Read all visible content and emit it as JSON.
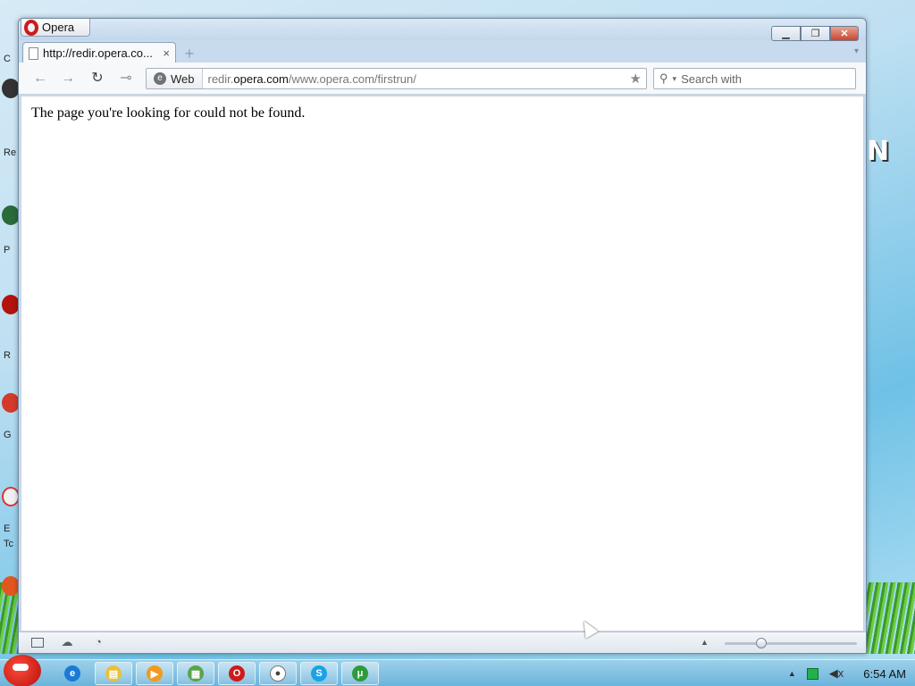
{
  "desktop": {
    "labels": [
      "C",
      "Re",
      "P",
      "R",
      "G",
      "E",
      "Tc"
    ],
    "watermark": "N"
  },
  "window": {
    "menu_label": "Opera",
    "controls": {
      "minimize": "▁",
      "restore": "❐",
      "close": "✕"
    },
    "tab": {
      "title": "http://redir.opera.co...",
      "close": "×"
    },
    "new_tab": "+",
    "tab_list": "▾"
  },
  "toolbar": {
    "back": "←",
    "forward": "→",
    "reload": "↻",
    "key": "⊸",
    "address": {
      "badge_icon": "e",
      "badge_label": "Web",
      "url_prefix": "redir.",
      "url_domain": "opera.com",
      "url_path": "/www.opera.com/firstrun/",
      "star": "★"
    },
    "search": {
      "icon": "⚲",
      "caret": "▾",
      "placeholder": "Search with"
    }
  },
  "content": {
    "message": "The page you're looking for could not be found."
  },
  "statusbar": {
    "panel_icon": "",
    "cloud_icon": "☁",
    "speed_icon": "◔",
    "up_arrow": "▲",
    "zoom_fraction": 0.28
  },
  "taskbar": {
    "items": [
      {
        "name": "ie",
        "glyph": "e",
        "color": "#1c7ad6"
      },
      {
        "name": "folder",
        "glyph": "▤",
        "color": "#e7c23a"
      },
      {
        "name": "media",
        "glyph": "▶",
        "color": "#f39a1d"
      },
      {
        "name": "files",
        "glyph": "▦",
        "color": "#5aa34a"
      },
      {
        "name": "opera",
        "glyph": "O",
        "color": "#cc1b1b"
      },
      {
        "name": "chat",
        "glyph": "●",
        "color": "#ffffff"
      },
      {
        "name": "skype",
        "glyph": "S",
        "color": "#1aa3e6"
      },
      {
        "name": "utorrent",
        "glyph": "μ",
        "color": "#2f9a3b"
      }
    ],
    "tray_up": "▲",
    "tray_volume": "◀x",
    "clock": "6:54 AM"
  }
}
